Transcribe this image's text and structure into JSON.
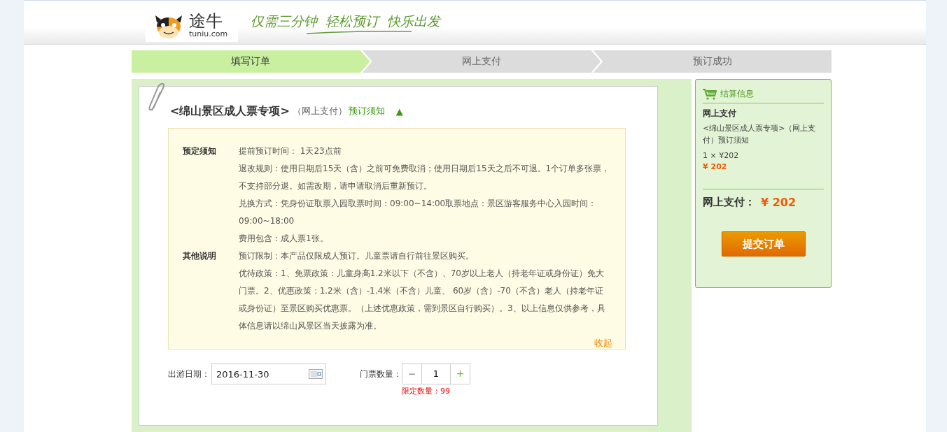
{
  "header": {
    "logo_cn": "途牛",
    "logo_en": "tuniu.com",
    "slogan": "仅需三分钟  轻松预订  快乐出发"
  },
  "steps": [
    {
      "label": "填写订单",
      "selected": true
    },
    {
      "label": "网上支付",
      "selected": false
    },
    {
      "label": "预订成功",
      "selected": false
    }
  ],
  "product": {
    "title": "<绵山景区成人票专项>",
    "pay_type": "（网上支付）",
    "notice_link": "预订须知",
    "toggle": "▲"
  },
  "notice": {
    "sections": [
      {
        "label": "预定须知",
        "lines": [
          "提前预订时间：  1天23点前",
          "退改规则：使用日期后15天（含）之前可免费取消；使用日期后15天之后不可退。1个订单多张票，不支持部分退。如需改期，请申请取消后重新预订。",
          "兑换方式：凭身份证取票入园取票时间：09:00~14:00取票地点：景区游客服务中心入园时间：09:00~18:00",
          "费用包含：成人票1张。"
        ]
      },
      {
        "label": "其他说明",
        "lines": [
          "预订限制：本产品仅限成人预订。儿童票请自行前往景区购买。",
          "优待政策：1、免票政策：儿童身高1.2米以下（不含）、70岁以上老人（持老年证或身份证）免大门票。2、优惠政策：1.2米（含）-1.4米（不含）儿童、 60岁（含）-70（不含）老人（持老年证或身份证）至景区购买优惠票。（上述优惠政策，需到景区自行购买）。3、以上信息仅供参考，具体信息请以绵山风景区当天披露为准。"
        ]
      }
    ],
    "collapse": "收起"
  },
  "form": {
    "date_label": "出游日期：",
    "date_value": "2016-11-30",
    "qty_label": "门票数量：",
    "minus": "−",
    "qty_value": "1",
    "plus": "+",
    "limit": "限定数量：99"
  },
  "summary": {
    "title": "结算信息",
    "pay_type": "网上支付",
    "item": "<绵山景区成人票专项>（网上支付）预订须知",
    "qty_price": "1 × ¥202",
    "subtotal": "¥ 202",
    "total_label": "网上支付：",
    "total": "¥ 202",
    "submit": "提交订单"
  }
}
